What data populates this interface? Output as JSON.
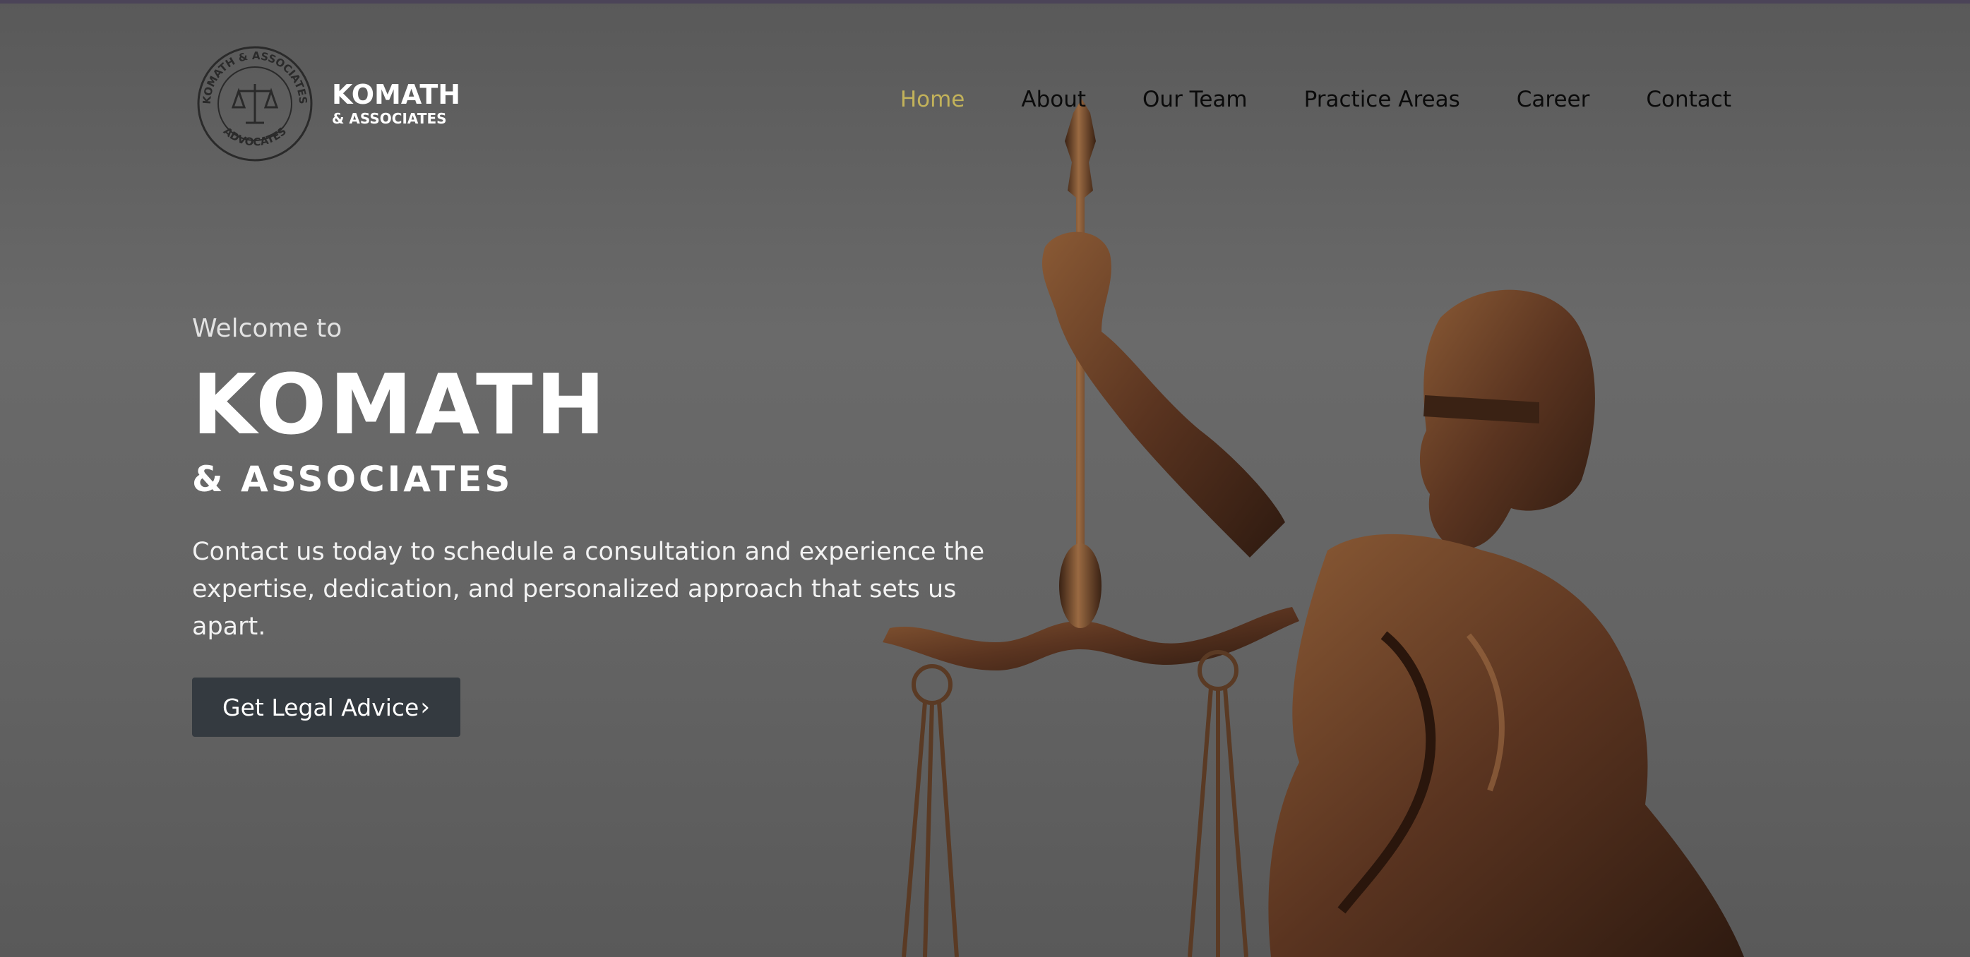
{
  "header": {
    "logo": {
      "name": "KOMATH",
      "sub": "& ASSOCIATES",
      "seal_top_text": "KOMATH & ASSOCIATES",
      "seal_bottom_text": "ADVOCATES",
      "icon": "scales-of-justice-icon"
    },
    "nav": [
      {
        "label": "Home",
        "active": true
      },
      {
        "label": "About",
        "active": false
      },
      {
        "label": "Our Team",
        "active": false
      },
      {
        "label": "Practice Areas",
        "active": false
      },
      {
        "label": "Career",
        "active": false
      },
      {
        "label": "Contact",
        "active": false
      }
    ]
  },
  "hero": {
    "welcome": "Welcome to",
    "title": "KOMATH",
    "subtitle": "& ASSOCIATES",
    "description": "Contact us today to schedule a consultation and experience the expertise, dedication, and personalized approach that sets us apart.",
    "cta_label": "Get Legal Advice",
    "cta_icon": "chevron-right-icon"
  },
  "colors": {
    "nav_active": "#c2b25a",
    "nav_text": "#0b0b0b",
    "cta_bg": "#343a40",
    "bronze": "#6b4326"
  }
}
